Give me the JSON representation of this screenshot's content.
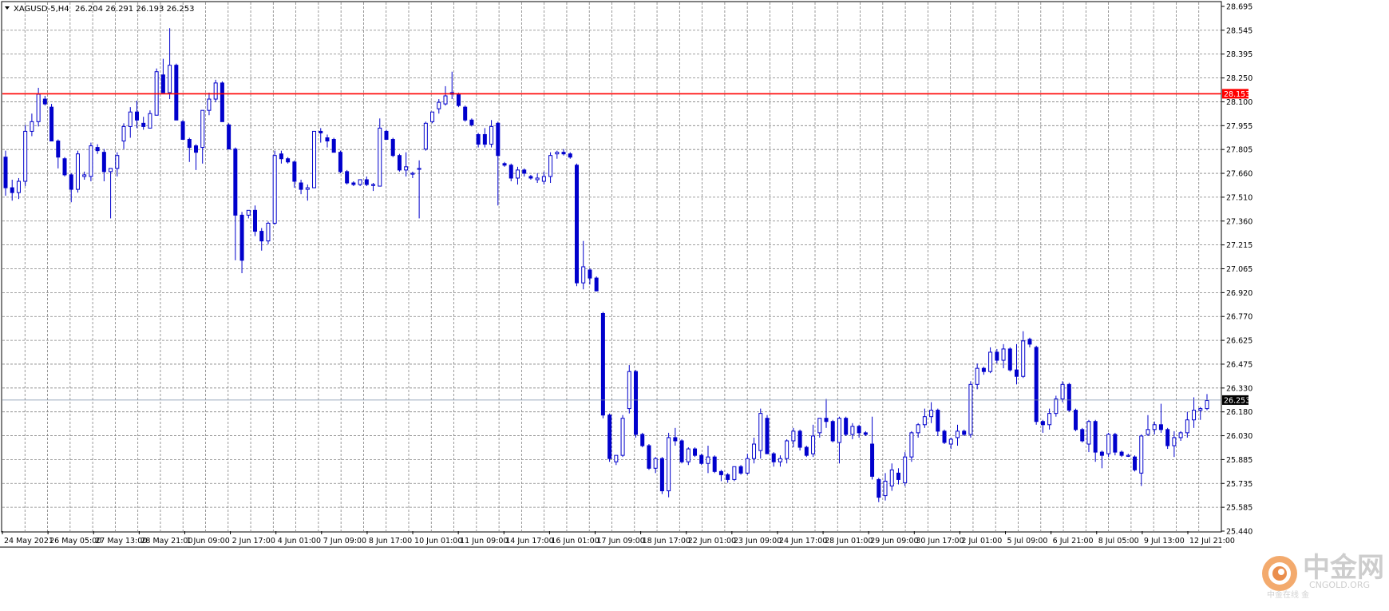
{
  "header": {
    "symbol_label": "XAGUSD-5,H4",
    "ohlc_label": "26.204 26.291 26.193 26.253"
  },
  "colors": {
    "candle": "#0000cc",
    "grid": "#808080",
    "level_line": "#ff0000",
    "level_box": "#ff0000",
    "bid_line": "#7b8fa8",
    "bid_box": "#000000",
    "frame": "#000000"
  },
  "watermark": {
    "brand": "中金网",
    "site": "CNGOLD.ORG",
    "tagline": "中金在线 金"
  },
  "chart_data": {
    "type": "candlestick",
    "title": "",
    "xlabel": "",
    "ylabel": "",
    "ylim": [
      25.44,
      28.695
    ],
    "grid": true,
    "y_ticks": [
      "28.695",
      "28.545",
      "28.395",
      "28.250",
      "28.100",
      "27.955",
      "27.805",
      "27.660",
      "27.510",
      "27.360",
      "27.215",
      "27.065",
      "26.920",
      "26.770",
      "26.625",
      "26.475",
      "26.330",
      "26.180",
      "26.030",
      "25.885",
      "25.735",
      "25.585",
      "25.440"
    ],
    "x_ticks": [
      "24 May 2021",
      "26 May 05:00",
      "27 May 13:00",
      "28 May 21:00",
      "1 Jun 09:00",
      "2 Jun 17:00",
      "4 Jun 01:00",
      "7 Jun 09:00",
      "8 Jun 17:00",
      "10 Jun 01:00",
      "11 Jun 09:00",
      "14 Jun 17:00",
      "16 Jun 01:00",
      "17 Jun 09:00",
      "18 Jun 17:00",
      "22 Jun 01:00",
      "23 Jun 09:00",
      "24 Jun 17:00",
      "28 Jun 01:00",
      "29 Jun 09:00",
      "30 Jun 17:00",
      "2 Jul 01:00",
      "5 Jul 09:00",
      "6 Jul 21:00",
      "8 Jul 05:00",
      "9 Jul 13:00",
      "12 Jul 21:00"
    ],
    "horizontal_levels": [
      {
        "value": 28.153,
        "label": "28.153",
        "color": "#ff0000"
      },
      {
        "value": 26.253,
        "label": "26.253",
        "color": "#7b8fa8"
      }
    ],
    "ohlc": [
      [
        27.76,
        27.8,
        27.52,
        27.57
      ],
      [
        27.57,
        27.62,
        27.49,
        27.54
      ],
      [
        27.54,
        27.63,
        27.5,
        27.61
      ],
      [
        27.61,
        27.96,
        27.58,
        27.92
      ],
      [
        27.92,
        28.03,
        27.89,
        27.98
      ],
      [
        27.98,
        28.19,
        27.95,
        28.15
      ],
      [
        28.12,
        28.14,
        28.08,
        28.09
      ],
      [
        28.07,
        28.09,
        27.86,
        27.86
      ],
      [
        27.86,
        27.87,
        27.69,
        27.76
      ],
      [
        27.75,
        27.76,
        27.64,
        27.65
      ],
      [
        27.65,
        27.66,
        27.48,
        27.56
      ],
      [
        27.56,
        27.8,
        27.54,
        27.78
      ],
      [
        27.64,
        27.67,
        27.62,
        27.65
      ],
      [
        27.64,
        27.85,
        27.61,
        27.83
      ],
      [
        27.82,
        27.84,
        27.78,
        27.8
      ],
      [
        27.79,
        27.81,
        27.61,
        27.67
      ],
      [
        27.67,
        27.69,
        27.38,
        27.69
      ],
      [
        27.69,
        27.79,
        27.64,
        27.77
      ],
      [
        27.86,
        27.97,
        27.81,
        27.95
      ],
      [
        27.95,
        28.07,
        27.88,
        28.04
      ],
      [
        28.04,
        28.11,
        27.94,
        27.99
      ],
      [
        27.97,
        28.01,
        27.93,
        27.95
      ],
      [
        27.94,
        28.05,
        27.94,
        28.03
      ],
      [
        28.02,
        28.31,
        28.02,
        28.29
      ],
      [
        28.27,
        28.37,
        28.16,
        28.16
      ],
      [
        28.16,
        28.56,
        28.12,
        28.33
      ],
      [
        28.33,
        28.34,
        28.14,
        27.99
      ],
      [
        27.98,
        27.99,
        27.87,
        27.87
      ],
      [
        27.87,
        27.88,
        27.73,
        27.82
      ],
      [
        27.83,
        27.84,
        27.68,
        27.79
      ],
      [
        27.82,
        28.02,
        27.72,
        28.05
      ],
      [
        28.05,
        28.16,
        28.02,
        28.12
      ],
      [
        28.12,
        28.24,
        28.1,
        28.22
      ],
      [
        28.22,
        28.23,
        27.98,
        27.98
      ],
      [
        27.96,
        27.97,
        27.81,
        27.81
      ],
      [
        27.81,
        27.82,
        27.12,
        27.4
      ],
      [
        27.4,
        27.42,
        27.04,
        27.12
      ],
      [
        27.4,
        27.42,
        27.38,
        27.43
      ],
      [
        27.43,
        27.46,
        27.27,
        27.3
      ],
      [
        27.3,
        27.32,
        27.18,
        27.24
      ],
      [
        27.24,
        27.36,
        27.22,
        27.35
      ],
      [
        27.35,
        27.8,
        27.34,
        27.77
      ],
      [
        27.78,
        27.8,
        27.72,
        27.75
      ],
      [
        27.75,
        27.76,
        27.72,
        27.73
      ],
      [
        27.73,
        27.74,
        27.57,
        27.61
      ],
      [
        27.6,
        27.62,
        27.53,
        27.56
      ],
      [
        27.56,
        27.59,
        27.49,
        27.57
      ],
      [
        27.57,
        27.91,
        27.57,
        27.92
      ],
      [
        27.92,
        27.94,
        27.85,
        27.91
      ],
      [
        27.88,
        27.9,
        27.82,
        27.86
      ],
      [
        27.87,
        27.88,
        27.79,
        27.79
      ],
      [
        27.79,
        27.8,
        27.66,
        27.67
      ],
      [
        27.67,
        27.68,
        27.59,
        27.6
      ],
      [
        27.6,
        27.61,
        27.58,
        27.59
      ],
      [
        27.59,
        27.62,
        27.58,
        27.62
      ],
      [
        27.62,
        27.64,
        27.58,
        27.59
      ],
      [
        27.59,
        27.6,
        27.55,
        27.59
      ],
      [
        27.58,
        28.0,
        27.58,
        27.94
      ],
      [
        27.92,
        27.93,
        27.87,
        27.87
      ],
      [
        27.87,
        27.88,
        27.76,
        27.77
      ],
      [
        27.77,
        27.78,
        27.67,
        27.68
      ],
      [
        27.68,
        27.79,
        27.64,
        27.7
      ],
      [
        27.66,
        27.67,
        27.63,
        27.66
      ],
      [
        27.69,
        27.74,
        27.38,
        27.69
      ],
      [
        27.81,
        27.98,
        27.8,
        27.97
      ],
      [
        27.98,
        28.04,
        27.97,
        28.04
      ],
      [
        28.06,
        28.12,
        28.03,
        28.1
      ],
      [
        28.09,
        28.2,
        28.08,
        28.14
      ],
      [
        28.16,
        28.29,
        28.12,
        28.15
      ],
      [
        28.15,
        28.16,
        28.07,
        28.08
      ],
      [
        28.07,
        28.08,
        27.98,
        27.99
      ],
      [
        27.99,
        28.0,
        27.95,
        27.96
      ],
      [
        27.9,
        27.91,
        27.82,
        27.84
      ],
      [
        27.9,
        27.94,
        27.82,
        27.84
      ],
      [
        27.84,
        27.99,
        27.82,
        27.95
      ],
      [
        27.97,
        27.98,
        27.46,
        27.77
      ],
      [
        27.72,
        27.73,
        27.7,
        27.71
      ],
      [
        27.71,
        27.72,
        27.61,
        27.63
      ],
      [
        27.63,
        27.7,
        27.59,
        27.68
      ],
      [
        27.68,
        27.69,
        27.64,
        27.66
      ],
      [
        27.64,
        27.65,
        27.62,
        27.63
      ],
      [
        27.62,
        27.66,
        27.6,
        27.63
      ],
      [
        27.61,
        27.67,
        27.59,
        27.64
      ],
      [
        27.64,
        27.79,
        27.6,
        27.77
      ],
      [
        27.78,
        27.8,
        27.75,
        27.79
      ],
      [
        27.79,
        27.81,
        27.77,
        27.78
      ],
      [
        27.78,
        27.79,
        27.75,
        27.76
      ],
      [
        27.71,
        27.72,
        26.96,
        26.98
      ],
      [
        26.98,
        27.24,
        26.94,
        27.08
      ],
      [
        27.06,
        27.07,
        26.97,
        27.01
      ],
      [
        27.01,
        27.02,
        26.93,
        26.93
      ],
      [
        26.79,
        26.8,
        26.14,
        26.16
      ],
      [
        26.16,
        26.17,
        25.87,
        25.89
      ],
      [
        25.87,
        25.9,
        25.85,
        25.91
      ],
      [
        25.91,
        26.16,
        25.9,
        26.14
      ],
      [
        26.2,
        26.47,
        26.17,
        26.43
      ],
      [
        26.43,
        26.44,
        26.02,
        26.04
      ],
      [
        26.04,
        26.05,
        25.96,
        25.97
      ],
      [
        25.97,
        25.98,
        25.82,
        25.83
      ],
      [
        25.83,
        25.9,
        25.8,
        25.89
      ],
      [
        25.89,
        25.9,
        25.67,
        25.69
      ],
      [
        25.69,
        26.05,
        25.65,
        26.02
      ],
      [
        26.02,
        26.08,
        25.97,
        26.0
      ],
      [
        26.0,
        26.01,
        25.86,
        25.87
      ],
      [
        25.87,
        25.96,
        25.85,
        25.95
      ],
      [
        25.95,
        25.96,
        25.9,
        25.91
      ],
      [
        25.91,
        25.92,
        25.85,
        25.86
      ],
      [
        25.86,
        25.97,
        25.8,
        25.9
      ],
      [
        25.9,
        25.91,
        25.8,
        25.81
      ],
      [
        25.81,
        25.82,
        25.75,
        25.79
      ],
      [
        25.79,
        25.8,
        25.74,
        25.76
      ],
      [
        25.76,
        25.84,
        25.75,
        25.84
      ],
      [
        25.84,
        25.85,
        25.79,
        25.8
      ],
      [
        25.8,
        25.92,
        25.79,
        25.89
      ],
      [
        25.89,
        26.02,
        25.86,
        25.98
      ],
      [
        25.94,
        26.2,
        25.89,
        26.17
      ],
      [
        26.14,
        26.16,
        25.92,
        25.92
      ],
      [
        25.92,
        25.93,
        25.84,
        25.87
      ],
      [
        25.87,
        25.91,
        25.84,
        25.89
      ],
      [
        25.89,
        26.01,
        25.86,
        26.0
      ],
      [
        26.0,
        26.08,
        25.96,
        26.06
      ],
      [
        26.06,
        26.07,
        25.94,
        25.96
      ],
      [
        25.96,
        25.97,
        25.9,
        25.91
      ],
      [
        25.92,
        26.1,
        25.9,
        26.03
      ],
      [
        26.05,
        26.14,
        26.02,
        26.14
      ],
      [
        26.14,
        26.26,
        26.08,
        26.12
      ],
      [
        26.12,
        26.13,
        25.99,
        26.0
      ],
      [
        25.99,
        26.15,
        25.86,
        26.14
      ],
      [
        26.14,
        26.15,
        26.03,
        26.04
      ],
      [
        26.04,
        26.11,
        26.01,
        26.09
      ],
      [
        26.09,
        26.1,
        26.02,
        26.05
      ],
      [
        26.05,
        26.06,
        26.03,
        26.04
      ],
      [
        25.98,
        26.15,
        25.76,
        25.78
      ],
      [
        25.76,
        25.77,
        25.62,
        25.65
      ],
      [
        25.66,
        25.8,
        25.63,
        25.75
      ],
      [
        25.72,
        25.86,
        25.69,
        25.82
      ],
      [
        25.8,
        25.83,
        25.73,
        25.76
      ],
      [
        25.74,
        25.93,
        25.72,
        25.9
      ],
      [
        25.9,
        26.06,
        25.87,
        26.05
      ],
      [
        26.05,
        26.11,
        26.02,
        26.1
      ],
      [
        26.1,
        26.2,
        26.08,
        26.15
      ],
      [
        26.15,
        26.24,
        26.11,
        26.19
      ],
      [
        26.19,
        26.2,
        26.03,
        26.06
      ],
      [
        26.06,
        26.07,
        25.98,
        25.99
      ],
      [
        25.98,
        26.02,
        25.95,
        26.01
      ],
      [
        26.02,
        26.1,
        25.97,
        26.06
      ],
      [
        26.06,
        26.07,
        26.03,
        26.04
      ],
      [
        26.04,
        26.37,
        26.02,
        26.35
      ],
      [
        26.35,
        26.48,
        26.32,
        26.45
      ],
      [
        26.45,
        26.46,
        26.41,
        26.43
      ],
      [
        26.43,
        26.58,
        26.42,
        26.55
      ],
      [
        26.55,
        26.57,
        26.48,
        26.5
      ],
      [
        26.5,
        26.6,
        26.45,
        26.57
      ],
      [
        26.57,
        26.58,
        26.43,
        26.44
      ],
      [
        26.44,
        26.6,
        26.35,
        26.4
      ],
      [
        26.4,
        26.68,
        26.39,
        26.62
      ],
      [
        26.63,
        26.64,
        26.58,
        26.6
      ],
      [
        26.58,
        26.59,
        26.1,
        26.12
      ],
      [
        26.12,
        26.13,
        26.05,
        26.1
      ],
      [
        26.1,
        26.2,
        26.07,
        26.17
      ],
      [
        26.17,
        26.28,
        26.15,
        26.26
      ],
      [
        26.26,
        26.37,
        26.24,
        26.35
      ],
      [
        26.35,
        26.36,
        26.18,
        26.19
      ],
      [
        26.19,
        26.2,
        26.06,
        26.07
      ],
      [
        26.07,
        26.08,
        25.99,
        26.0
      ],
      [
        25.98,
        26.13,
        25.93,
        26.12
      ],
      [
        26.12,
        26.13,
        25.87,
        25.93
      ],
      [
        25.93,
        25.94,
        25.83,
        25.91
      ],
      [
        25.92,
        26.05,
        25.9,
        26.04
      ],
      [
        26.04,
        26.05,
        25.91,
        25.93
      ],
      [
        25.93,
        25.94,
        25.9,
        25.91
      ],
      [
        25.91,
        25.92,
        25.9,
        25.91
      ],
      [
        25.9,
        25.91,
        25.81,
        25.82
      ],
      [
        25.8,
        26.04,
        25.72,
        26.03
      ],
      [
        26.04,
        26.16,
        26.03,
        26.07
      ],
      [
        26.07,
        26.12,
        26.04,
        26.1
      ],
      [
        26.1,
        26.23,
        26.05,
        26.07
      ],
      [
        26.07,
        26.08,
        25.95,
        25.97
      ],
      [
        25.97,
        26.06,
        25.9,
        26.02
      ],
      [
        26.02,
        26.06,
        26.0,
        26.05
      ],
      [
        26.05,
        26.18,
        26.02,
        26.13
      ],
      [
        26.13,
        26.27,
        26.08,
        26.19
      ],
      [
        26.19,
        26.21,
        26.13,
        26.2
      ],
      [
        26.2,
        26.29,
        26.19,
        26.25
      ]
    ]
  }
}
